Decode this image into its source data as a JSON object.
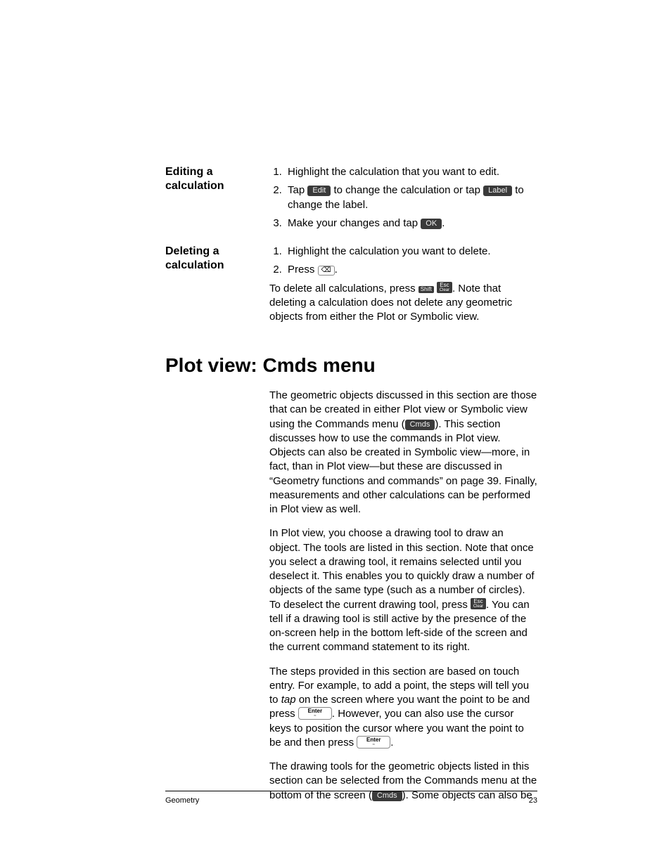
{
  "editing": {
    "heading": "Editing a calculation",
    "step1": "Highlight the calculation that you want to edit.",
    "step2a": "Tap ",
    "step2_edit": "Edit",
    "step2b": " to change the calculation or tap ",
    "step2_label": "Label",
    "step2c": " to change the label.",
    "step3a": "Make your changes and tap ",
    "step3_ok": "OK",
    "step3b": "."
  },
  "deleting": {
    "heading": "Deleting a calculation",
    "step1": "Highlight the calculation you want to delete.",
    "step2a": "Press ",
    "step2_del": "⌫",
    "step2b": ".",
    "p1a": "To delete all calculations, press ",
    "p1_shift": "Shift",
    "p1_esc_top": "Esc",
    "p1_esc_sub": "Clear",
    "p1b": ". Note that deleting a calculation does not delete any geometric objects from either the Plot or Symbolic view."
  },
  "section": {
    "title": "Plot view: Cmds menu",
    "p1a": "The geometric objects discussed in this section are those that can be created in either Plot view or Symbolic view using the Commands menu (",
    "p1_cmds": "Cmds",
    "p1b": "). This section discusses how to use the commands in Plot view. Objects can also be created in Symbolic view—more, in fact, than in Plot view—but these are discussed in “Geometry functions and commands” on page 39. Finally, measurements and other calculations can be performed in Plot view as well.",
    "p2a": "In Plot view, you choose a drawing tool to draw an object. The tools are listed in this section. Note that once you select a drawing tool, it remains selected until you deselect it. This enables you to quickly draw a number of objects of the same type (such as a number of circles). To deselect the current drawing tool, press ",
    "p2_esc_top": "Esc",
    "p2_esc_sub": "Clear",
    "p2b": ". You can tell if a drawing tool is still active by the presence of the on-screen help in the bottom left-side of the screen and the current command statement to its right.",
    "p3a": "The steps provided in this section are based on touch entry. For example, to add a point, the steps will tell you to ",
    "p3_tap": "tap",
    "p3b": " on the screen where you want the point to be and press ",
    "p3_enter_top": "Enter",
    "p3_enter_sub": "≈",
    "p3c": ". However, you can also use the cursor keys to position the cursor where you want the point to be and then press ",
    "p3d": ".",
    "p4a": "The drawing tools for the geometric objects listed in this section can be selected from the Commands menu at the bottom of the screen (",
    "p4_cmds": "Cmds",
    "p4b": "). Some objects can also be"
  },
  "footer": {
    "left": "Geometry",
    "right": "23"
  }
}
